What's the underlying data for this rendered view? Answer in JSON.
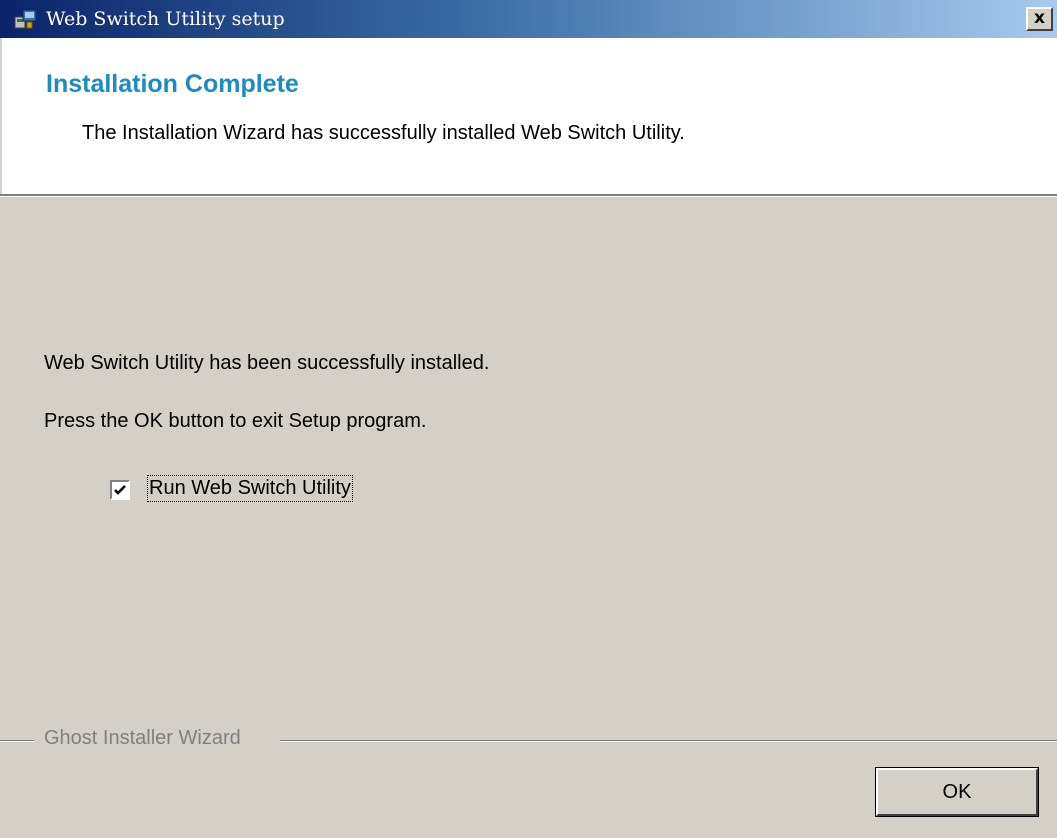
{
  "window": {
    "title": "Web Switch Utility setup",
    "title_icon": "installer-icon",
    "close_label": "x"
  },
  "header": {
    "title": "Installation Complete",
    "subtitle": "The Installation Wizard has successfully installed Web Switch Utility.",
    "title_color": "#1c8bc4"
  },
  "body": {
    "message_installed": "Web Switch Utility has been successfully installed.",
    "message_exit": "Press the OK button to exit Setup program.",
    "run_checkbox": {
      "label": "Run Web Switch Utility",
      "checked": true
    }
  },
  "footer": {
    "group_label": "Ghost Installer Wizard",
    "ok_label": "OK"
  }
}
